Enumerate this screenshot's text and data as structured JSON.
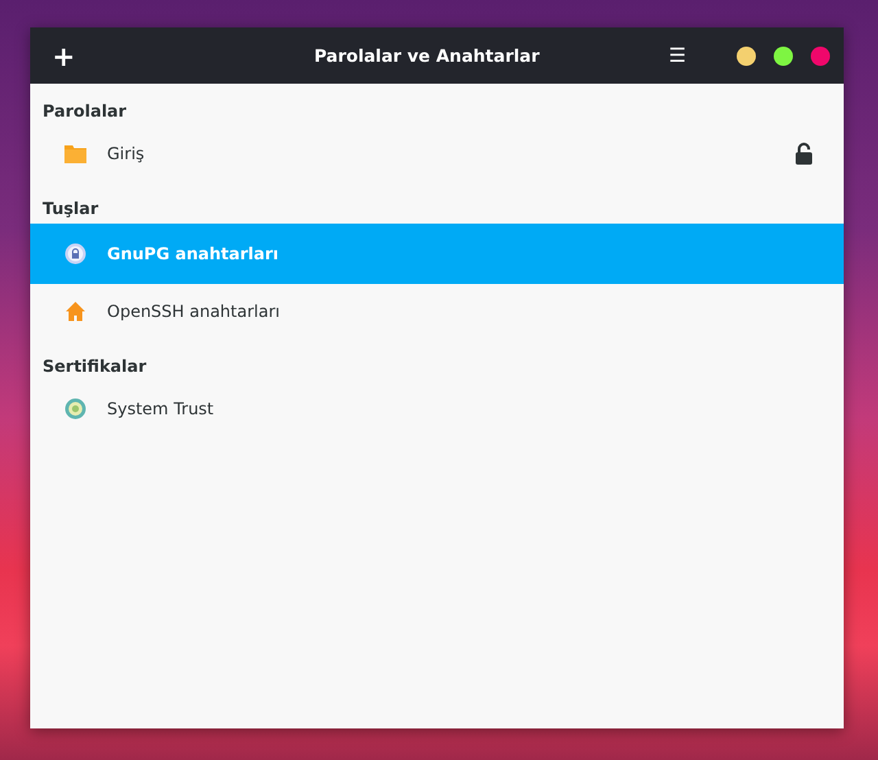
{
  "window": {
    "title": "Parolalar ve Anahtarlar",
    "add_button": "+",
    "menu_button": "☰",
    "controls": [
      {
        "color": "#f4d06f"
      },
      {
        "color": "#7ef542"
      },
      {
        "color": "#f0076b"
      }
    ]
  },
  "sections": [
    {
      "title": "Parolalar",
      "items": [
        {
          "label": "Giriş",
          "kind": "folder",
          "selected": false,
          "locked": false
        }
      ]
    },
    {
      "title": "Tuşlar",
      "items": [
        {
          "label": "GnuPG anahtarları",
          "kind": "gpg",
          "selected": true
        },
        {
          "label": "OpenSSH anahtarları",
          "kind": "home",
          "selected": false
        }
      ]
    },
    {
      "title": "Sertifikalar",
      "items": [
        {
          "label": "System Trust",
          "kind": "cert",
          "selected": false
        }
      ]
    }
  ]
}
